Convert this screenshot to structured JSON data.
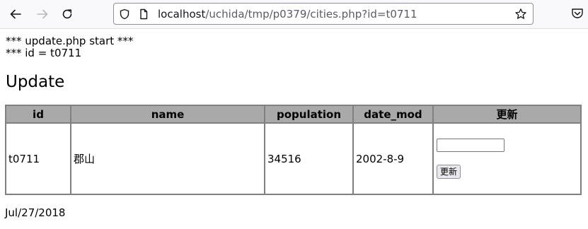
{
  "browser": {
    "url_host": "localhost",
    "url_path": "/uchida/tmp/p0379/cities.php?id=t0711"
  },
  "page": {
    "debug_start": "*** update.php start ***",
    "debug_id": "*** id = t0711",
    "title": "Update",
    "table": {
      "headers": [
        "id",
        "name",
        "population",
        "date_mod",
        "更新"
      ],
      "row": {
        "id": "t0711",
        "name": "郡山",
        "population": "34516",
        "date_mod": "2002-8-9"
      },
      "input_value": "",
      "button_label": "更新"
    },
    "footer_date": "Jul/27/2018"
  },
  "icons": {
    "back": "arrow-left-icon",
    "forward": "arrow-right-icon",
    "reload": "reload-icon",
    "security": "shield-icon",
    "page_info": "page-icon",
    "bookmark": "star-icon",
    "pocket": "pocket-icon"
  },
  "colors": {
    "header_bg": "#a9a9a9",
    "border": "#808080",
    "toolbar_bg": "#f9f9fb"
  }
}
